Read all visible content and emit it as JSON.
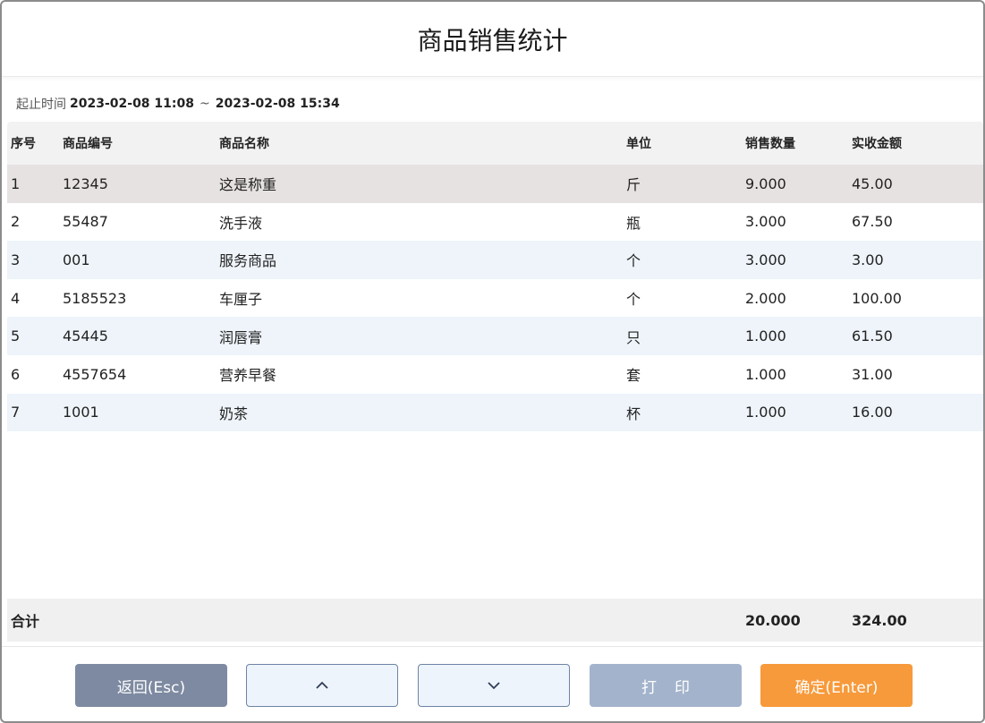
{
  "title": "商品销售统计",
  "time_range": {
    "label": "起止时间",
    "start": "2023-02-08 11:08",
    "separator": "~",
    "end": "2023-02-08 15:34"
  },
  "table": {
    "headers": {
      "seq": "序号",
      "code": "商品编号",
      "name": "商品名称",
      "unit": "单位",
      "qty": "销售数量",
      "amount": "实收金额"
    },
    "selected_row": 0,
    "rows": [
      {
        "seq": "1",
        "code": "12345",
        "name": "这是称重",
        "unit": "斤",
        "qty": "9.000",
        "amount": "45.00"
      },
      {
        "seq": "2",
        "code": "55487",
        "name": "洗手液",
        "unit": "瓶",
        "qty": "3.000",
        "amount": "67.50"
      },
      {
        "seq": "3",
        "code": "001",
        "name": "服务商品",
        "unit": "个",
        "qty": "3.000",
        "amount": "3.00"
      },
      {
        "seq": "4",
        "code": "5185523",
        "name": "车厘子",
        "unit": "个",
        "qty": "2.000",
        "amount": "100.00"
      },
      {
        "seq": "5",
        "code": "45445",
        "name": "润唇膏",
        "unit": "只",
        "qty": "1.000",
        "amount": "61.50"
      },
      {
        "seq": "6",
        "code": "4557654",
        "name": "营养早餐",
        "unit": "套",
        "qty": "1.000",
        "amount": "31.00"
      },
      {
        "seq": "7",
        "code": "1001",
        "name": "奶茶",
        "unit": "杯",
        "qty": "1.000",
        "amount": "16.00"
      }
    ]
  },
  "total": {
    "label": "合计",
    "qty": "20.000",
    "amount": "324.00"
  },
  "buttons": {
    "back": "返回(Esc)",
    "up_icon": "chevron-up-icon",
    "down_icon": "chevron-down-icon",
    "print": "打印",
    "confirm": "确定(Enter)"
  },
  "colors": {
    "selected_row": "#e6e2e1",
    "alt_row": "#eef4fa",
    "back_button": "#7d8aa1",
    "print_button": "#a3b3cc",
    "confirm_button": "#f79a3b"
  }
}
